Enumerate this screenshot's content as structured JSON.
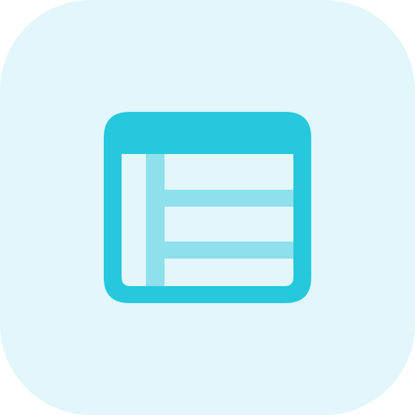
{
  "app_icon": {
    "icon_name": "table-layout-icon",
    "colors": {
      "background": "#E2F6FB",
      "frame": "#26C8DC",
      "rows": "#8DE0EC",
      "interior": "#E2F6FB"
    }
  }
}
